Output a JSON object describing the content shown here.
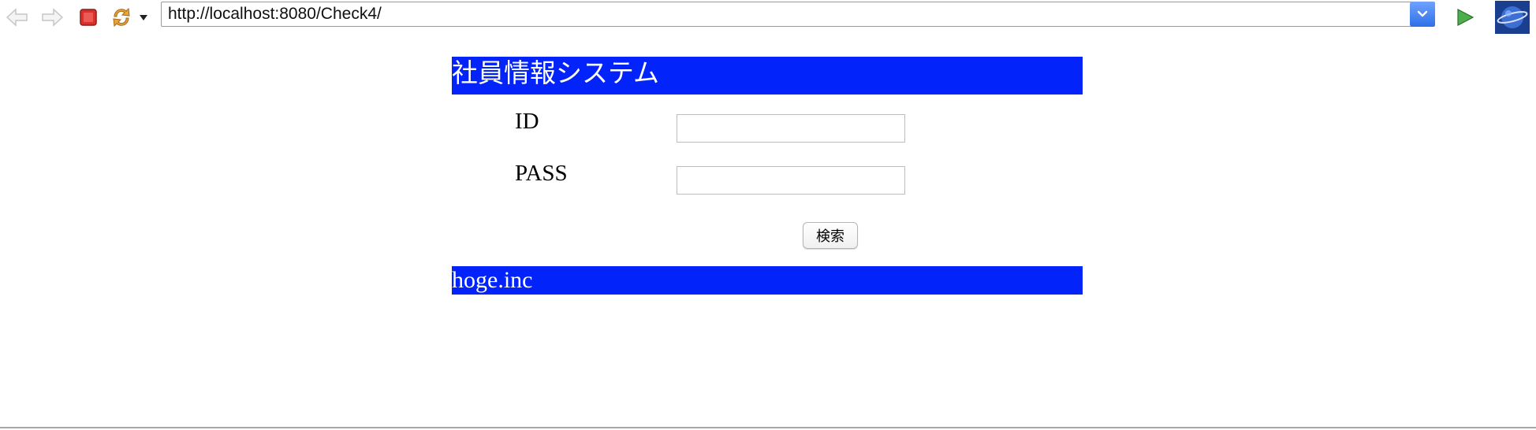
{
  "browser": {
    "url": "http://localhost:8080/Check4/",
    "icons": {
      "back": "arrow-left-icon",
      "forward": "arrow-right-icon",
      "stop": "stop-icon",
      "refresh": "refresh-icon",
      "refresh_menu": "chevron-down-icon",
      "url_dropdown": "chevron-down-icon",
      "go": "play-icon",
      "browser_logo": "globe-icon"
    }
  },
  "page": {
    "header_title": "社員情報システム",
    "form": {
      "id_label": "ID",
      "id_value": "",
      "pass_label": "PASS",
      "pass_value": "",
      "search_label": "検索"
    },
    "footer_text": "hoge.inc"
  },
  "colors": {
    "bar_blue": "#0323fb",
    "text_white": "#ffffff",
    "stop_red": "#d9302c",
    "refresh_orange": "#e9a13a",
    "go_green": "#4cae4c"
  }
}
